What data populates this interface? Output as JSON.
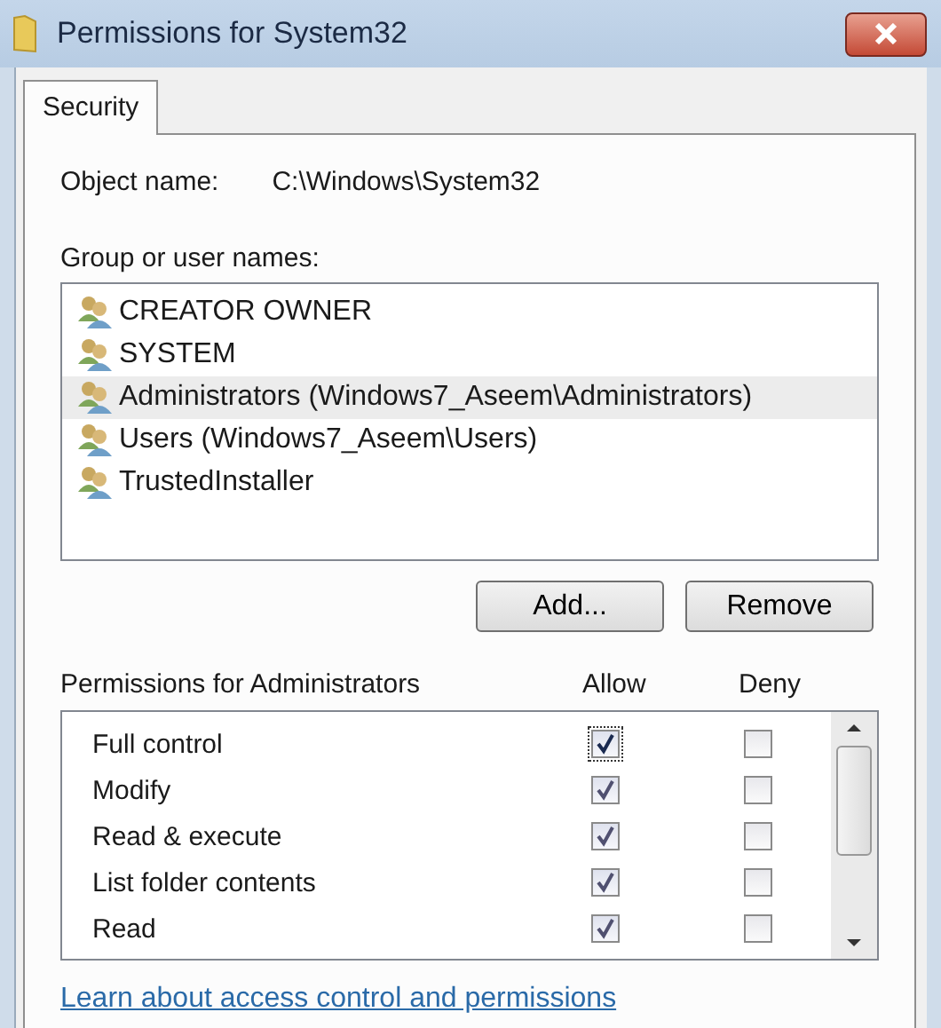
{
  "window": {
    "title": "Permissions for System32"
  },
  "tabs": [
    {
      "label": "Security",
      "selected": true
    }
  ],
  "object_name": {
    "label": "Object name:",
    "value": "C:\\Windows\\System32"
  },
  "group_list": {
    "label": "Group or user names:",
    "items": [
      {
        "name": "CREATOR OWNER",
        "selected": false
      },
      {
        "name": "SYSTEM",
        "selected": false
      },
      {
        "name": "Administrators (Windows7_Aseem\\Administrators)",
        "selected": true
      },
      {
        "name": "Users (Windows7_Aseem\\Users)",
        "selected": false
      },
      {
        "name": "TrustedInstaller",
        "selected": false
      }
    ]
  },
  "buttons": [
    "Add...",
    "Remove"
  ],
  "permissions": {
    "label": "Permissions for Administrators",
    "allow_header": "Allow",
    "deny_header": "Deny",
    "rows": [
      {
        "name": "Full control",
        "allow": true,
        "deny": false,
        "focused": true
      },
      {
        "name": "Modify",
        "allow": true,
        "deny": false,
        "focused": false
      },
      {
        "name": "Read & execute",
        "allow": true,
        "deny": false,
        "focused": false
      },
      {
        "name": "List folder contents",
        "allow": true,
        "deny": false,
        "focused": false
      },
      {
        "name": "Read",
        "allow": true,
        "deny": false,
        "focused": false
      }
    ]
  },
  "link": "Learn about access control and permissions"
}
